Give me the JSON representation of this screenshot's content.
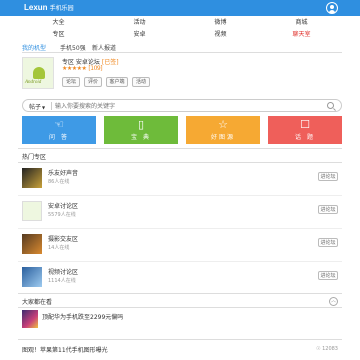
{
  "header": {
    "brand": "Lexun",
    "brand_sub": "手机乐园"
  },
  "nav": {
    "items": [
      {
        "label": "大全"
      },
      {
        "label": "活动"
      },
      {
        "label": "微博"
      },
      {
        "label": "商城"
      },
      {
        "label": "专区"
      },
      {
        "label": "安卓"
      },
      {
        "label": "视频"
      },
      {
        "label": "聊天室",
        "color": "#e0322d"
      }
    ]
  },
  "tabs": [
    {
      "label": "我的机型",
      "active": true
    },
    {
      "label": "手机50强"
    },
    {
      "label": "新人报道"
    }
  ],
  "forum": {
    "logo_text": "Android",
    "title": "专区 安卓论坛",
    "status": "[已签]",
    "stars": "★★★★★",
    "rating_count": "[109]",
    "buttons": [
      "论坛",
      "评价",
      "客户端",
      "活动"
    ]
  },
  "search": {
    "type_label": "帖子",
    "placeholder": "输入你要搜索的关键字"
  },
  "tiles": [
    {
      "label": "问 答",
      "icon": "hand-icon",
      "color": "#3e9ae6"
    },
    {
      "label": "宝 典",
      "icon": "book-icon",
      "color": "#6ebb3a"
    },
    {
      "label": "好图源",
      "icon": "star-icon",
      "color": "#f6a933"
    },
    {
      "label": "话 题",
      "icon": "chat-icon",
      "color": "#ef5f5a"
    }
  ],
  "hot_section": {
    "title": "热门专区"
  },
  "hot_rows": [
    {
      "name": "乐友好声音",
      "online": "86人在线",
      "enter": "进论坛"
    },
    {
      "name": "安卓讨论区",
      "online": "5579人在线",
      "enter": "进论坛"
    },
    {
      "name": "摄影交友区",
      "online": "14人在线",
      "enter": "进论坛"
    },
    {
      "name": "视频讨论区",
      "online": "1114人在线",
      "enter": "进论坛"
    }
  ],
  "watching": {
    "title": "大家都在看"
  },
  "news": [
    {
      "title": "顶配华为手机跌至2299元偏吗"
    },
    {
      "title": "图观！苹果第11代手机图形曝光",
      "meta": "☉ 12083"
    }
  ],
  "colors": {
    "accent": "#2f8fe0",
    "orange": "#f08a24",
    "red": "#e0322d"
  }
}
